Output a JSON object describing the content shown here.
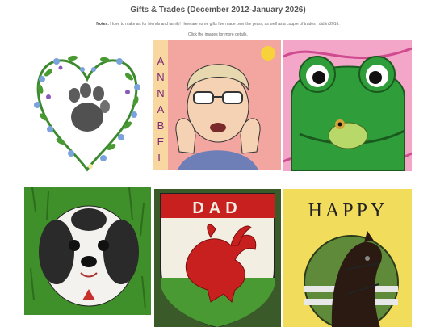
{
  "page": {
    "title": "Gifts & Trades (December 2012-January 2026)",
    "notes_label": "Notes:",
    "notes_text": "I love to make art for friends and family! Here are some gifts I've made over the years, as well as a couple of trades I did in 2016.",
    "hint": "Click the images for more details."
  },
  "gallery": [
    {
      "name": "paw-print-wreath",
      "text": ""
    },
    {
      "name": "annabel-portrait",
      "text": "ANNABEL"
    },
    {
      "name": "frog-painting",
      "text": ""
    },
    {
      "name": "shih-tzu-painting",
      "text": ""
    },
    {
      "name": "dad-dragon-shield",
      "text": "DAD"
    },
    {
      "name": "happy-horse-card",
      "text": "HAPPY"
    }
  ],
  "colors": {
    "frog_green": "#2f9e3a",
    "dragon_red": "#c8201e",
    "card_yellow": "#f2dc5c",
    "grass_green": "#3f8f2a"
  }
}
